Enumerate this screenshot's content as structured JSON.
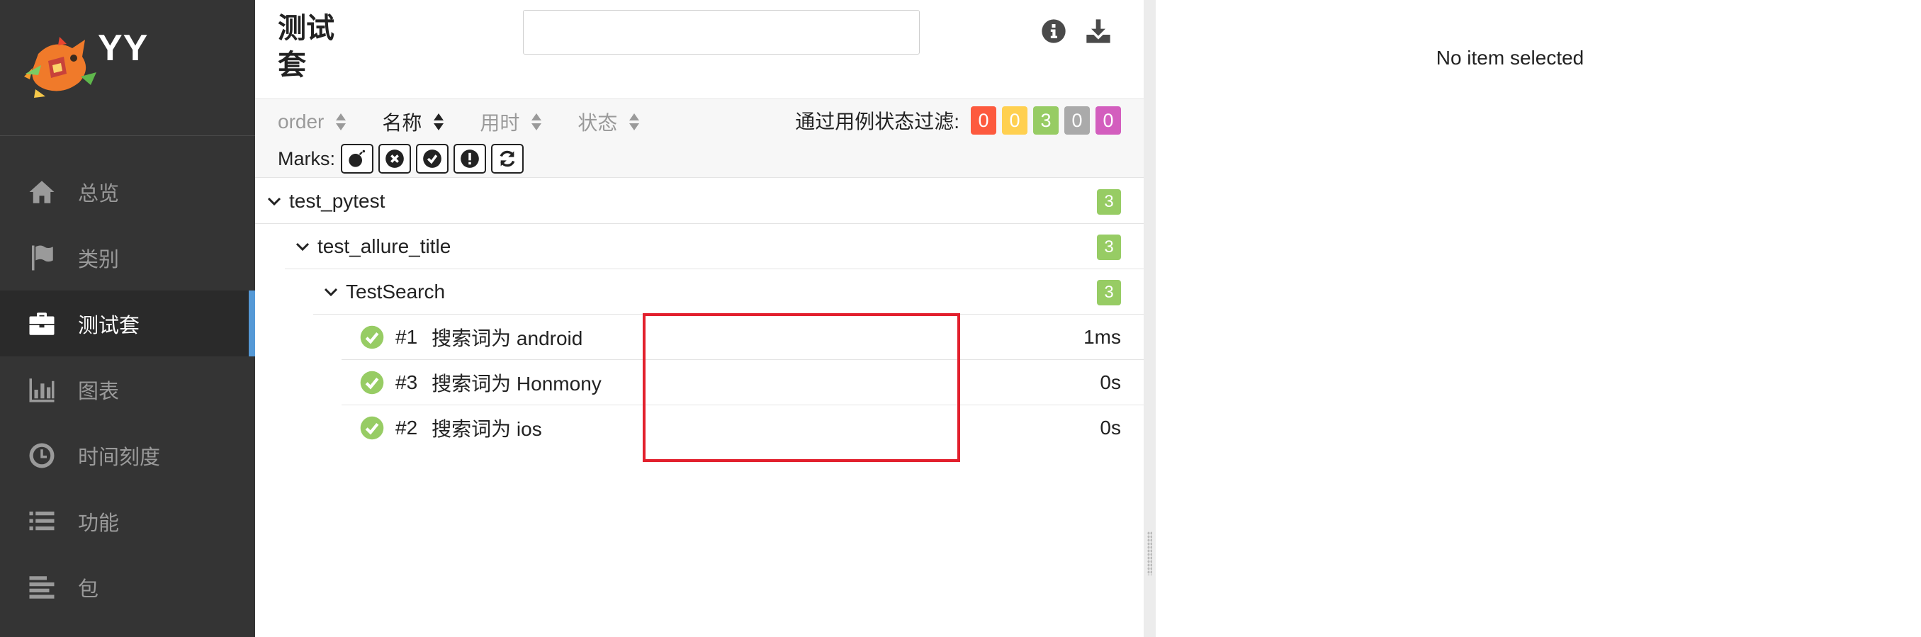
{
  "brand": {
    "name": "YY"
  },
  "sidebar": {
    "items": [
      {
        "label": "总览",
        "icon": "home-icon"
      },
      {
        "label": "类别",
        "icon": "flag-icon"
      },
      {
        "label": "测试套",
        "icon": "briefcase-icon",
        "active": true
      },
      {
        "label": "图表",
        "icon": "bar-chart-icon"
      },
      {
        "label": "时间刻度",
        "icon": "clock-icon"
      },
      {
        "label": "功能",
        "icon": "list-icon"
      },
      {
        "label": "包",
        "icon": "align-left-icon"
      }
    ]
  },
  "tree_pane": {
    "title": "测试套",
    "search": {
      "value": "",
      "placeholder": ""
    },
    "sort": [
      {
        "label": "order",
        "active": false
      },
      {
        "label": "名称",
        "active": true
      },
      {
        "label": "用时",
        "active": false
      },
      {
        "label": "状态",
        "active": false
      }
    ],
    "filter": {
      "label": "通过用例状态过滤:",
      "badges": [
        {
          "count": "0",
          "status": "failed",
          "color": "#fd5a3e"
        },
        {
          "count": "0",
          "status": "broken",
          "color": "#ffd050"
        },
        {
          "count": "3",
          "status": "passed",
          "color": "#97cc64"
        },
        {
          "count": "0",
          "status": "skipped",
          "color": "#aaaaaa"
        },
        {
          "count": "0",
          "status": "unknown",
          "color": "#d35ebe"
        }
      ]
    },
    "marks": {
      "label": "Marks:",
      "buttons": [
        "bomb-icon",
        "x-circle-icon",
        "check-circle-icon",
        "exclamation-circle-icon",
        "refresh-icon"
      ]
    },
    "tree": {
      "groups": [
        {
          "name": "test_pytest",
          "count": "3"
        },
        {
          "name": "test_allure_title",
          "count": "3"
        },
        {
          "name": "TestSearch",
          "count": "3"
        }
      ],
      "cases": [
        {
          "order": "#1",
          "name": "搜索词为 android",
          "time": "1ms",
          "status": "passed"
        },
        {
          "order": "#3",
          "name": "搜索词为 Honmony",
          "time": "0s",
          "status": "passed"
        },
        {
          "order": "#2",
          "name": "搜索词为 ios",
          "time": "0s",
          "status": "passed"
        }
      ]
    }
  },
  "detail_pane": {
    "empty_message": "No item selected"
  }
}
